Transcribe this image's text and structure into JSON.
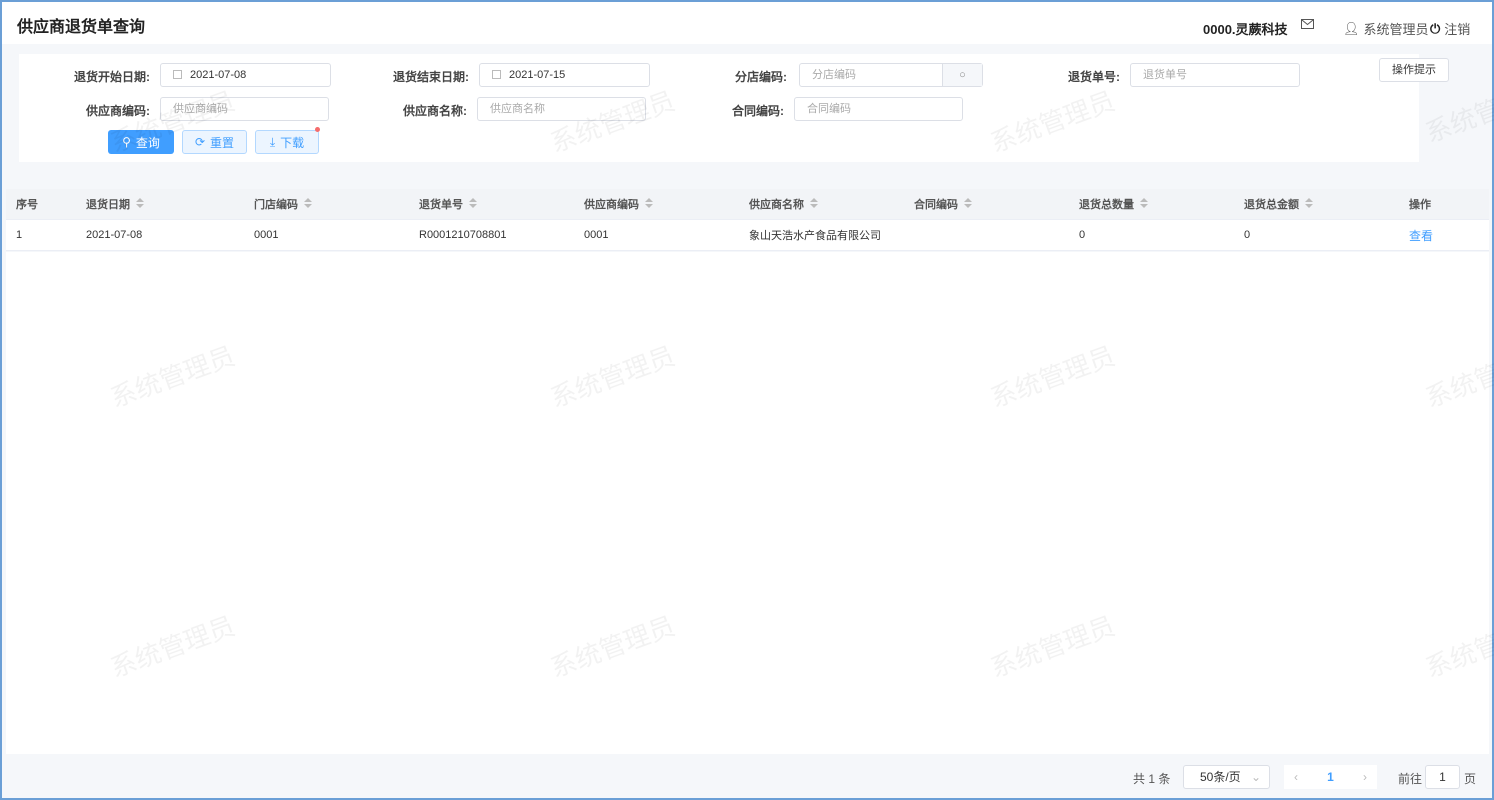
{
  "page": {
    "title": "供应商退货单查询",
    "company": "0000.灵蕨科技",
    "user": "系统管理员",
    "logout": "注销",
    "watermark": "系统管理员"
  },
  "filters": {
    "start_date": {
      "label": "退货开始日期:",
      "value": "2021-07-08"
    },
    "end_date": {
      "label": "退货结束日期:",
      "value": "2021-07-15"
    },
    "store_code": {
      "label": "分店编码:",
      "placeholder": "分店编码"
    },
    "return_no": {
      "label": "退货单号:",
      "placeholder": "退货单号"
    },
    "supplier_code": {
      "label": "供应商编码:",
      "placeholder": "供应商编码"
    },
    "supplier_name": {
      "label": "供应商名称:",
      "placeholder": "供应商名称"
    },
    "contract_code": {
      "label": "合同编码:",
      "placeholder": "合同编码"
    },
    "help": "操作提示",
    "query": "查询",
    "reset": "重置",
    "download": "下载"
  },
  "table": {
    "columns": [
      "序号",
      "退货日期",
      "门店编码",
      "退货单号",
      "供应商编码",
      "供应商名称",
      "合同编码",
      "退货总数量",
      "退货总金额",
      "操作"
    ],
    "rows": [
      [
        "1",
        "2021-07-08",
        "0001",
        "R0001210708801",
        "0001",
        "象山天浩水产食品有限公司",
        "",
        "0",
        "0",
        "查看"
      ]
    ]
  },
  "pagination": {
    "total": "共 1 条",
    "page_size": "50条/页",
    "current": "1",
    "goto": "前往",
    "goto_value": "1",
    "page_unit": "页"
  }
}
